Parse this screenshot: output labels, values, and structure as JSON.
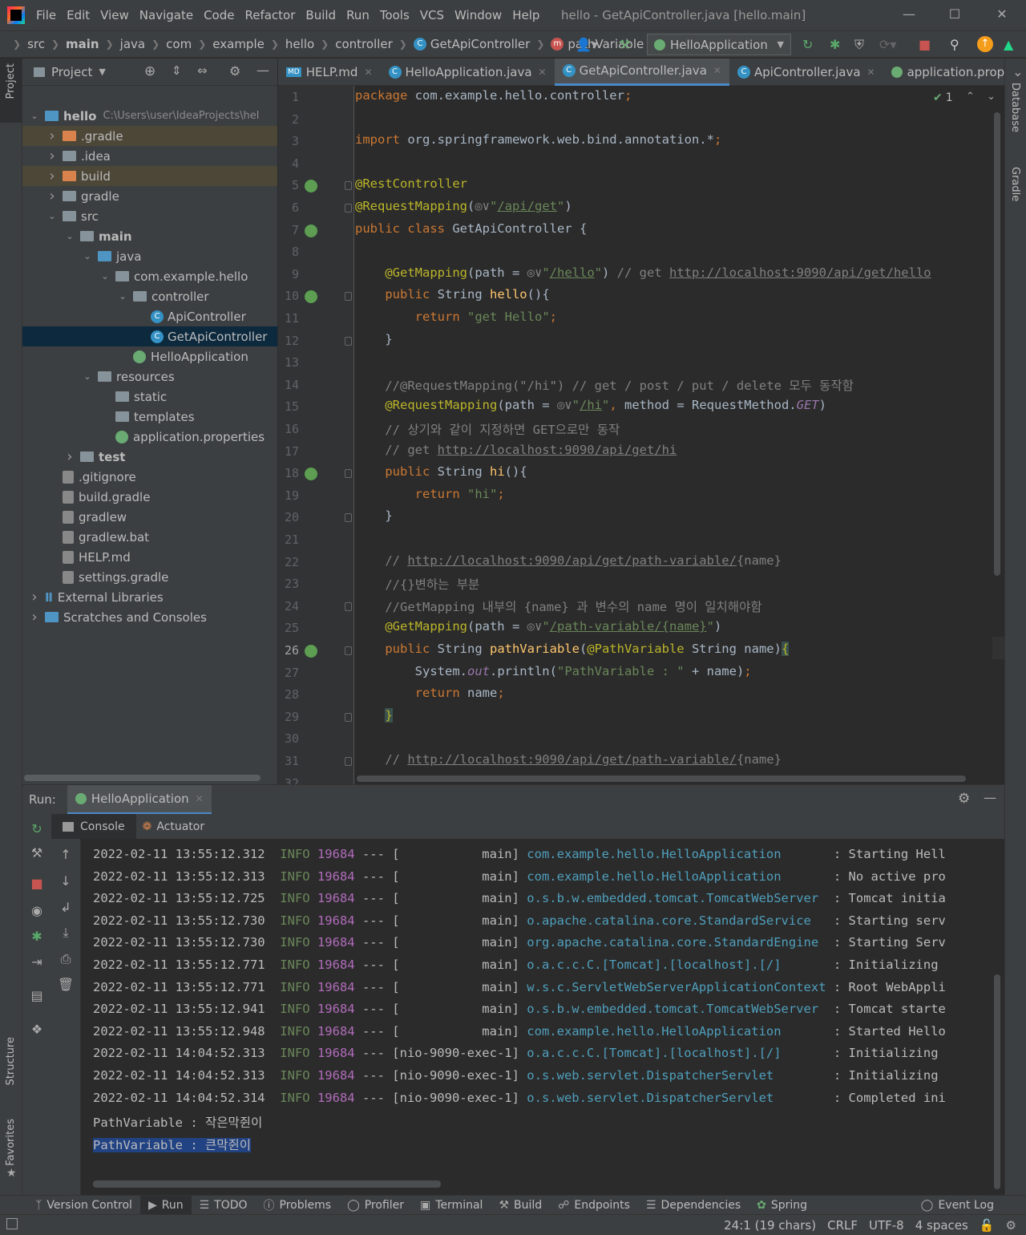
{
  "menu": {
    "items": [
      "File",
      "Edit",
      "View",
      "Navigate",
      "Code",
      "Refactor",
      "Build",
      "Run",
      "Tools",
      "VCS",
      "Window",
      "Help"
    ],
    "window_title": "hello - GetApiController.java [hello.main]"
  },
  "navbar": {
    "crumbs": [
      "src",
      "main",
      "java",
      "com",
      "example",
      "hello",
      "controller",
      "GetApiController",
      "pathVariable"
    ],
    "run_config": "HelloApplication"
  },
  "left_stripe": {
    "project": "Project",
    "structure": "Structure",
    "favorites": "Favorites"
  },
  "right_stripe": {
    "database": "Database",
    "gradle": "Gradle"
  },
  "project": {
    "title": "Project",
    "root_path": "C:\\Users\\user\\IdeaProjects\\hel",
    "tree": [
      {
        "label": "hello",
        "indent": 0,
        "arrow": "down",
        "icon": "module"
      },
      {
        "label": ".gradle",
        "indent": 1,
        "arrow": "right",
        "icon": "folder-orange"
      },
      {
        "label": ".idea",
        "indent": 1,
        "arrow": "right",
        "icon": "folder"
      },
      {
        "label": "build",
        "indent": 1,
        "arrow": "right",
        "icon": "folder-orange"
      },
      {
        "label": "gradle",
        "indent": 1,
        "arrow": "right",
        "icon": "folder"
      },
      {
        "label": "src",
        "indent": 1,
        "arrow": "down",
        "icon": "folder"
      },
      {
        "label": "main",
        "indent": 2,
        "arrow": "down",
        "icon": "folder"
      },
      {
        "label": "java",
        "indent": 3,
        "arrow": "down",
        "icon": "folder-blue"
      },
      {
        "label": "com.example.hello",
        "indent": 4,
        "arrow": "down",
        "icon": "folder"
      },
      {
        "label": "controller",
        "indent": 5,
        "arrow": "down",
        "icon": "folder"
      },
      {
        "label": "ApiController",
        "indent": 6,
        "arrow": "",
        "icon": "class"
      },
      {
        "label": "GetApiController",
        "indent": 6,
        "arrow": "",
        "icon": "class"
      },
      {
        "label": "HelloApplication",
        "indent": 5,
        "arrow": "",
        "icon": "spring"
      },
      {
        "label": "resources",
        "indent": 3,
        "arrow": "down",
        "icon": "folder"
      },
      {
        "label": "static",
        "indent": 4,
        "arrow": "",
        "icon": "folder"
      },
      {
        "label": "templates",
        "indent": 4,
        "arrow": "",
        "icon": "folder"
      },
      {
        "label": "application.properties",
        "indent": 4,
        "arrow": "",
        "icon": "spring"
      },
      {
        "label": "test",
        "indent": 2,
        "arrow": "right",
        "icon": "folder"
      },
      {
        "label": ".gitignore",
        "indent": 1,
        "arrow": "",
        "icon": "file"
      },
      {
        "label": "build.gradle",
        "indent": 1,
        "arrow": "",
        "icon": "file"
      },
      {
        "label": "gradlew",
        "indent": 1,
        "arrow": "",
        "icon": "file"
      },
      {
        "label": "gradlew.bat",
        "indent": 1,
        "arrow": "",
        "icon": "file"
      },
      {
        "label": "HELP.md",
        "indent": 1,
        "arrow": "",
        "icon": "file"
      },
      {
        "label": "settings.gradle",
        "indent": 1,
        "arrow": "",
        "icon": "file"
      },
      {
        "label": "External Libraries",
        "indent": 0,
        "arrow": "right",
        "icon": "lib"
      },
      {
        "label": "Scratches and Consoles",
        "indent": 0,
        "arrow": "right",
        "icon": "scratch"
      }
    ]
  },
  "editor": {
    "tabs": [
      {
        "label": "HELP.md",
        "active": false
      },
      {
        "label": "HelloApplication.java",
        "active": false
      },
      {
        "label": "GetApiController.java",
        "active": true
      },
      {
        "label": "ApiController.java",
        "active": false
      },
      {
        "label": "application.prop",
        "active": false
      }
    ],
    "inspection_count": "1",
    "current_line": "26"
  },
  "run": {
    "label": "Run:",
    "tab": "HelloApplication",
    "subtabs": [
      "Console",
      "Actuator"
    ]
  },
  "console": {
    "lines": [
      {
        "ts": "2022-02-11 13:55:12.312",
        "level": "INFO",
        "pid": "19684",
        "thread": "[           main]",
        "logger": "com.example.hello.HelloApplication      ",
        "msg": "Starting Hell"
      },
      {
        "ts": "2022-02-11 13:55:12.313",
        "level": "INFO",
        "pid": "19684",
        "thread": "[           main]",
        "logger": "com.example.hello.HelloApplication      ",
        "msg": "No active pro"
      },
      {
        "ts": "2022-02-11 13:55:12.725",
        "level": "INFO",
        "pid": "19684",
        "thread": "[           main]",
        "logger": "o.s.b.w.embedded.tomcat.TomcatWebServer ",
        "msg": "Tomcat initia"
      },
      {
        "ts": "2022-02-11 13:55:12.730",
        "level": "INFO",
        "pid": "19684",
        "thread": "[           main]",
        "logger": "o.apache.catalina.core.StandardService  ",
        "msg": "Starting serv"
      },
      {
        "ts": "2022-02-11 13:55:12.730",
        "level": "INFO",
        "pid": "19684",
        "thread": "[           main]",
        "logger": "org.apache.catalina.core.StandardEngine ",
        "msg": "Starting Serv"
      },
      {
        "ts": "2022-02-11 13:55:12.771",
        "level": "INFO",
        "pid": "19684",
        "thread": "[           main]",
        "logger": "o.a.c.c.C.[Tomcat].[localhost].[/]      ",
        "msg": "Initializing "
      },
      {
        "ts": "2022-02-11 13:55:12.771",
        "level": "INFO",
        "pid": "19684",
        "thread": "[           main]",
        "logger": "w.s.c.ServletWebServerApplicationContext",
        "msg": "Root WebAppli"
      },
      {
        "ts": "2022-02-11 13:55:12.941",
        "level": "INFO",
        "pid": "19684",
        "thread": "[           main]",
        "logger": "o.s.b.w.embedded.tomcat.TomcatWebServer ",
        "msg": "Tomcat starte"
      },
      {
        "ts": "2022-02-11 13:55:12.948",
        "level": "INFO",
        "pid": "19684",
        "thread": "[           main]",
        "logger": "com.example.hello.HelloApplication      ",
        "msg": "Started Hello"
      },
      {
        "ts": "2022-02-11 14:04:52.313",
        "level": "INFO",
        "pid": "19684",
        "thread": "[nio-9090-exec-1]",
        "logger": "o.a.c.c.C.[Tomcat].[localhost].[/]      ",
        "msg": "Initializing "
      },
      {
        "ts": "2022-02-11 14:04:52.313",
        "level": "INFO",
        "pid": "19684",
        "thread": "[nio-9090-exec-1]",
        "logger": "o.s.web.servlet.DispatcherServlet       ",
        "msg": "Initializing "
      },
      {
        "ts": "2022-02-11 14:04:52.314",
        "level": "INFO",
        "pid": "19684",
        "thread": "[nio-9090-exec-1]",
        "logger": "o.s.web.servlet.DispatcherServlet       ",
        "msg": "Completed ini"
      }
    ],
    "output1": "PathVariable : 작은막쥔이",
    "output2": "PathVariable : 큰막쥔이"
  },
  "toolbar": {
    "items": [
      "Version Control",
      "Run",
      "TODO",
      "Problems",
      "Profiler",
      "Terminal",
      "Build",
      "Endpoints",
      "Dependencies",
      "Spring"
    ],
    "event_log": "Event Log"
  },
  "status": {
    "position": "24:1 (19 chars)",
    "line_sep": "CRLF",
    "encoding": "UTF-8",
    "indent": "4 spaces"
  },
  "colors": {
    "accent": "#4a88c7",
    "selection": "#214283",
    "tree_selected": "#0d293e"
  }
}
